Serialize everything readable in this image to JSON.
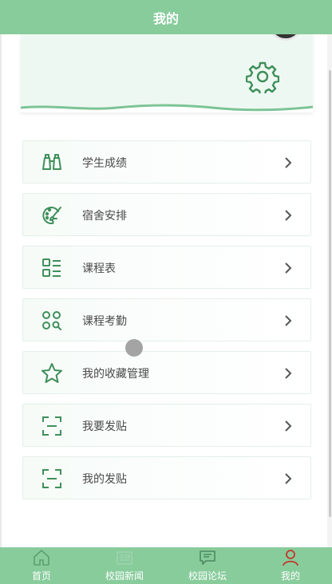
{
  "header": {
    "title": "我的"
  },
  "menu": [
    {
      "label": "学生成绩",
      "icon": "binoculars-icon"
    },
    {
      "label": "宿舍安排",
      "icon": "palette-brush-icon"
    },
    {
      "label": "课程表",
      "icon": "list-grid-icon"
    },
    {
      "label": "课程考勤",
      "icon": "grid-search-icon"
    },
    {
      "label": "我的收藏管理",
      "icon": "star-icon"
    },
    {
      "label": "我要发贴",
      "icon": "scan-frame-icon"
    },
    {
      "label": "我的发贴",
      "icon": "scan-frame-icon"
    }
  ],
  "tabs": [
    {
      "label": "首页",
      "icon": "home-icon"
    },
    {
      "label": "校园新闻",
      "icon": "news-icon"
    },
    {
      "label": "校园论坛",
      "icon": "chat-icon"
    },
    {
      "label": "我的",
      "icon": "user-icon",
      "active": true
    }
  ],
  "colors": {
    "primary": "#88cc9c",
    "icon_green": "#3f8f5a",
    "active_tab": "#c0392b"
  }
}
